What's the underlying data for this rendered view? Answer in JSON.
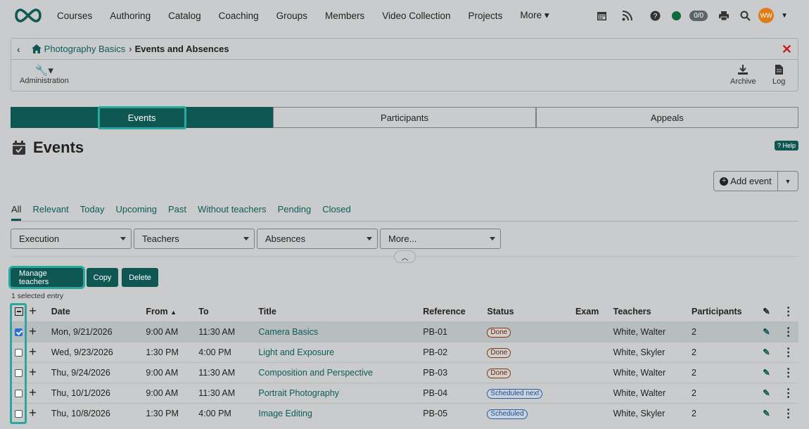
{
  "nav": {
    "items": [
      "Courses",
      "Authoring",
      "Catalog",
      "Coaching",
      "Groups",
      "Members",
      "Video Collection",
      "Projects",
      "More"
    ],
    "counter": "0/0",
    "avatar": "WW"
  },
  "breadcrumb": {
    "parent": "Photography Basics",
    "current": "Events and Absences"
  },
  "toolbar": {
    "admin": "Administration",
    "archive": "Archive",
    "log": "Log"
  },
  "tabs": [
    "Events",
    "Participants",
    "Appeals"
  ],
  "page": {
    "title": "Events",
    "help": "Help",
    "add_event": "Add event"
  },
  "filter_tabs": [
    "All",
    "Relevant",
    "Today",
    "Upcoming",
    "Past",
    "Without teachers",
    "Pending",
    "Closed"
  ],
  "dropdowns": [
    "Execution",
    "Teachers",
    "Absences",
    "More..."
  ],
  "actions": {
    "manage": "Manage teachers",
    "copy": "Copy",
    "delete": "Delete",
    "selected": "1 selected entry"
  },
  "table": {
    "headers": {
      "date": "Date",
      "from": "From",
      "to": "To",
      "title": "Title",
      "reference": "Reference",
      "status": "Status",
      "exam": "Exam",
      "teachers": "Teachers",
      "participants": "Participants"
    },
    "rows": [
      {
        "date": "Mon, 9/21/2026",
        "from": "9:00 AM",
        "to": "11:30 AM",
        "title": "Camera Basics",
        "ref": "PB-01",
        "status": "Done",
        "teachers": "White, Walter",
        "participants": "2",
        "checked": true
      },
      {
        "date": "Wed, 9/23/2026",
        "from": "1:30 PM",
        "to": "4:00 PM",
        "title": "Light and Exposure",
        "ref": "PB-02",
        "status": "Done",
        "teachers": "White, Skyler",
        "participants": "2",
        "checked": false
      },
      {
        "date": "Thu, 9/24/2026",
        "from": "9:00 AM",
        "to": "11:30 AM",
        "title": "Composition and Perspective",
        "ref": "PB-03",
        "status": "Done",
        "teachers": "White, Walter",
        "participants": "2",
        "checked": false
      },
      {
        "date": "Thu, 10/1/2026",
        "from": "9:00 AM",
        "to": "11:30 AM",
        "title": "Portrait Photography",
        "ref": "PB-04",
        "status": "Scheduled next",
        "teachers": "White, Walter",
        "participants": "2",
        "checked": false
      },
      {
        "date": "Thu, 10/8/2026",
        "from": "1:30 PM",
        "to": "4:00 PM",
        "title": "Image Editing",
        "ref": "PB-05",
        "status": "Scheduled",
        "teachers": "White, Skyler",
        "participants": "2",
        "checked": false
      }
    ]
  }
}
